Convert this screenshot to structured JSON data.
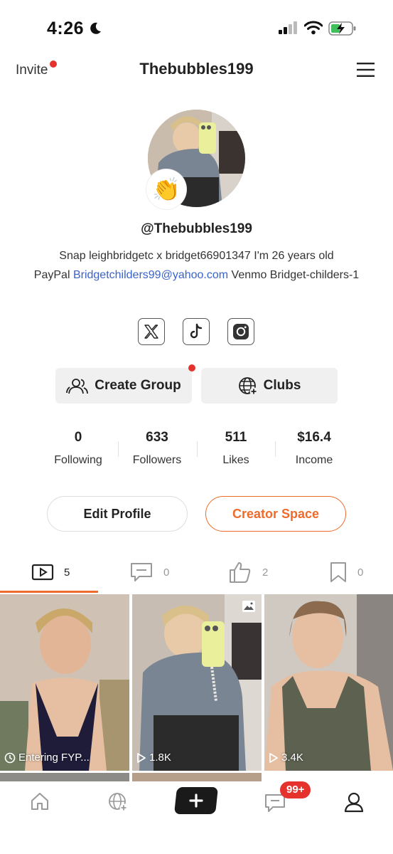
{
  "status_bar": {
    "time": "4:26"
  },
  "header": {
    "invite_label": "Invite",
    "title": "Thebubbles199"
  },
  "profile": {
    "handle": "@Thebubbles199",
    "bio_line1": "Snap  leighbridgetc x bridget66901347 I'm 26 years old",
    "bio_paypal_label": "PayPal",
    "bio_email": "Bridgetchilders99@yahoo.com",
    "bio_venmo": "Venmo Bridget-childers-1",
    "badge_emoji": "👏"
  },
  "social": [
    "x-icon",
    "tiktok-icon",
    "instagram-icon"
  ],
  "groups": {
    "create_group_label": "Create Group",
    "clubs_label": "Clubs"
  },
  "stats": [
    {
      "value": "0",
      "label": "Following"
    },
    {
      "value": "633",
      "label": "Followers"
    },
    {
      "value": "511",
      "label": "Likes"
    },
    {
      "value": "$16.4",
      "label": "Income"
    }
  ],
  "actions": {
    "edit_profile": "Edit Profile",
    "creator_space": "Creator Space"
  },
  "tabs": [
    {
      "icon": "video-icon",
      "count": "5"
    },
    {
      "icon": "comment-icon",
      "count": "0"
    },
    {
      "icon": "thumbs-up-icon",
      "count": "2"
    },
    {
      "icon": "bookmark-icon",
      "count": "0"
    }
  ],
  "posts": [
    {
      "caption": "Entering FYP...",
      "icon": "clock-icon"
    },
    {
      "caption": "1.8K",
      "icon": "play-icon"
    },
    {
      "caption": "3.4K",
      "icon": "play-icon"
    }
  ],
  "bottom_nav": {
    "messages_badge": "99+"
  },
  "colors": {
    "accent": "#ee6b2b",
    "alert": "#e5322d",
    "link": "#3b63c7"
  }
}
